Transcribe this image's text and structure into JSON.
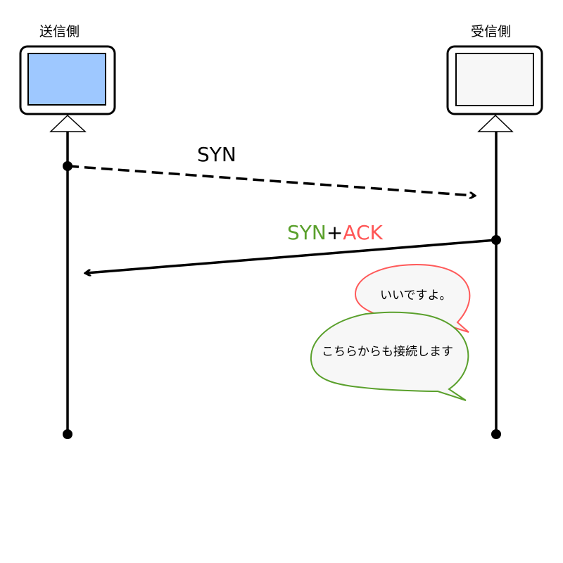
{
  "nodes": {
    "sender": {
      "label": "送信側",
      "screen_color": "#9ec8ff"
    },
    "receiver": {
      "label": "受信側",
      "screen_color": "#f7f7f7"
    }
  },
  "messages": {
    "syn": {
      "label": "SYN",
      "style": "dashed"
    },
    "synack": {
      "label_part1": "SYN",
      "label_plus": "+",
      "label_part2": "ACK",
      "color_part1": "#5aa02c",
      "color_part2": "#ff5555",
      "style": "solid"
    }
  },
  "bubbles": {
    "red": {
      "text": "いいですよ。",
      "stroke": "#ff5a5a"
    },
    "green": {
      "text": "こちらからも接続します",
      "stroke": "#5aa02c"
    }
  }
}
